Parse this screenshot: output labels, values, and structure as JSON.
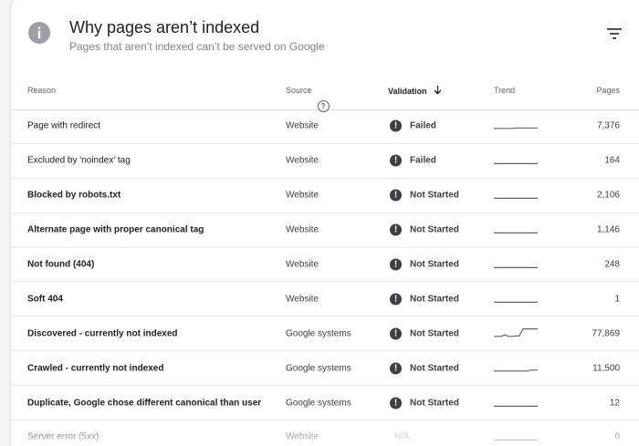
{
  "header": {
    "title": "Why pages aren’t indexed",
    "subtitle": "Pages that aren’t indexed can’t be served on Google"
  },
  "table": {
    "columns": {
      "reason": "Reason",
      "source": "Source",
      "validation": "Validation",
      "trend": "Trend",
      "pages": "Pages"
    },
    "rows": [
      {
        "reason": "Page with redirect",
        "bold": false,
        "source": "Website",
        "validation": "Failed",
        "pages": "7,376",
        "trend": [
          0.15,
          0.15,
          0.15,
          0.15,
          0.15,
          0.15,
          0.2,
          0.2,
          0.2,
          0.2,
          0.2,
          0.2,
          0.2
        ]
      },
      {
        "reason": "Excluded by 'noindex' tag",
        "bold": false,
        "source": "Website",
        "validation": "Failed",
        "pages": "164",
        "trend": [
          0.1,
          0.1,
          0.1,
          0.1,
          0.1,
          0.1,
          0.1,
          0.1,
          0.1,
          0.1,
          0.1,
          0.1,
          0.1
        ]
      },
      {
        "reason": "Blocked by robots.txt",
        "bold": true,
        "source": "Website",
        "validation": "Not Started",
        "pages": "2,106",
        "trend": [
          0.1,
          0.1,
          0.1,
          0.1,
          0.1,
          0.1,
          0.1,
          0.1,
          0.1,
          0.1,
          0.1,
          0.1,
          0.1
        ]
      },
      {
        "reason": "Alternate page with proper canonical tag",
        "bold": true,
        "source": "Website",
        "validation": "Not Started",
        "pages": "1,146",
        "trend": [
          0.1,
          0.1,
          0.1,
          0.1,
          0.1,
          0.1,
          0.1,
          0.1,
          0.1,
          0.1,
          0.1,
          0.1,
          0.1
        ]
      },
      {
        "reason": "Not found (404)",
        "bold": true,
        "source": "Website",
        "validation": "Not Started",
        "pages": "248",
        "trend": [
          0.1,
          0.1,
          0.1,
          0.1,
          0.1,
          0.1,
          0.1,
          0.1,
          0.1,
          0.1,
          0.1,
          0.1,
          0.1
        ]
      },
      {
        "reason": "Soft 404",
        "bold": true,
        "source": "Website",
        "validation": "Not Started",
        "pages": "1",
        "trend": [
          0.1,
          0.1,
          0.1,
          0.1,
          0.1,
          0.1,
          0.1,
          0.1,
          0.1,
          0.1,
          0.1,
          0.1,
          0.1
        ]
      },
      {
        "reason": "Discovered - currently not indexed",
        "bold": true,
        "source": "Google systems",
        "validation": "Not Started",
        "pages": "77,869",
        "trend": [
          0.15,
          0.15,
          0.15,
          0.3,
          0.15,
          0.15,
          0.2,
          0.2,
          0.9,
          0.9,
          0.9,
          0.9,
          0.9
        ]
      },
      {
        "reason": "Crawled - currently not indexed",
        "bold": true,
        "source": "Google systems",
        "validation": "Not Started",
        "pages": "11,500",
        "trend": [
          0.15,
          0.15,
          0.15,
          0.15,
          0.15,
          0.15,
          0.15,
          0.15,
          0.15,
          0.15,
          0.25,
          0.25,
          0.25
        ]
      },
      {
        "reason": "Duplicate, Google chose different canonical than user",
        "bold": true,
        "source": "Google systems",
        "validation": "Not Started",
        "pages": "12",
        "trend": [
          0.1,
          0.1,
          0.1,
          0.1,
          0.1,
          0.1,
          0.1,
          0.1,
          0.1,
          0.1,
          0.1,
          0.1,
          0.1
        ]
      },
      {
        "reason": "Server error (5xx)",
        "bold": false,
        "source": "Website",
        "validation": "N/A",
        "pages": "0",
        "trend": [
          0.1,
          0.1,
          0.1,
          0.1,
          0.1,
          0.1,
          0.1,
          0.1,
          0.1,
          0.1,
          0.1,
          0.1,
          0.1
        ]
      }
    ]
  },
  "icons": {
    "header": "info-icon",
    "filter": "filter-icon",
    "source_help": "help-icon",
    "sort": "arrow-down-icon",
    "status": "alert-icon"
  },
  "colors": {
    "status_icon": "#3c4043",
    "trend_line": "#5f6368",
    "info_icon": "#9aa0a6"
  }
}
